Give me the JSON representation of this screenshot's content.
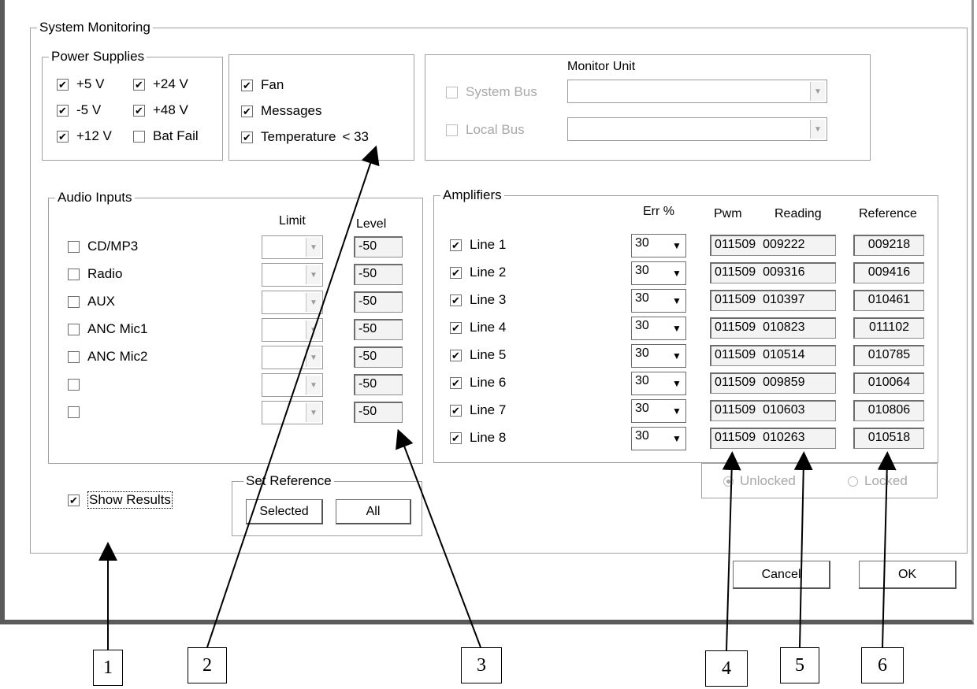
{
  "system_monitoring": {
    "title": "System Monitoring",
    "power_supplies": {
      "title": "Power Supplies",
      "items": [
        {
          "label": "+5 V",
          "checked": true
        },
        {
          "label": "+24 V",
          "checked": true
        },
        {
          "label": "-5 V",
          "checked": true
        },
        {
          "label": "+48 V",
          "checked": true
        },
        {
          "label": "+12 V",
          "checked": true
        },
        {
          "label": "Bat Fail",
          "checked": false
        }
      ]
    },
    "misc": {
      "fan": {
        "label": "Fan",
        "checked": true
      },
      "messages": {
        "label": "Messages",
        "checked": true
      },
      "temperature": {
        "label": "Temperature",
        "checked": true,
        "value": "< 33"
      }
    },
    "monitor_unit": {
      "title": "Monitor Unit",
      "system_bus": {
        "label": "System Bus",
        "checked": false,
        "value": ""
      },
      "local_bus": {
        "label": "Local Bus",
        "checked": false,
        "value": ""
      }
    },
    "audio_inputs": {
      "title": "Audio Inputs",
      "headers": {
        "limit": "Limit",
        "level": "Level"
      },
      "rows": [
        {
          "label": "CD/MP3",
          "checked": false,
          "limit": "",
          "level": "-50"
        },
        {
          "label": "Radio",
          "checked": false,
          "limit": "",
          "level": "-50"
        },
        {
          "label": "AUX",
          "checked": false,
          "limit": "",
          "level": "-50"
        },
        {
          "label": "ANC Mic1",
          "checked": false,
          "limit": "",
          "level": "-50"
        },
        {
          "label": "ANC Mic2",
          "checked": false,
          "limit": "",
          "level": "-50"
        },
        {
          "label": "",
          "checked": false,
          "limit": "",
          "level": "-50"
        },
        {
          "label": "",
          "checked": false,
          "limit": "",
          "level": "-50"
        }
      ]
    },
    "amplifiers": {
      "title": "Amplifiers",
      "headers": {
        "err": "Err %",
        "pwm": "Pwm",
        "reading": "Reading",
        "reference": "Reference"
      },
      "rows": [
        {
          "label": "Line 1",
          "checked": true,
          "err": "30",
          "pwm_reading": "011509  009222",
          "reference": "009218"
        },
        {
          "label": "Line 2",
          "checked": true,
          "err": "30",
          "pwm_reading": "011509  009316",
          "reference": "009416"
        },
        {
          "label": "Line 3",
          "checked": true,
          "err": "30",
          "pwm_reading": "011509  010397",
          "reference": "010461"
        },
        {
          "label": "Line 4",
          "checked": true,
          "err": "30",
          "pwm_reading": "011509  010823",
          "reference": "011102"
        },
        {
          "label": "Line 5",
          "checked": true,
          "err": "30",
          "pwm_reading": "011509  010514",
          "reference": "010785"
        },
        {
          "label": "Line 6",
          "checked": true,
          "err": "30",
          "pwm_reading": "011509  009859",
          "reference": "010064"
        },
        {
          "label": "Line 7",
          "checked": true,
          "err": "30",
          "pwm_reading": "011509  010603",
          "reference": "010806"
        },
        {
          "label": "Line 8",
          "checked": true,
          "err": "30",
          "pwm_reading": "011509  010263",
          "reference": "010518"
        }
      ],
      "lock": {
        "unlocked_label": "Unlocked",
        "locked_label": "Locked",
        "selected": "unlocked"
      }
    },
    "show_results": {
      "label": "Show Results",
      "checked": true
    },
    "set_reference": {
      "title": "Set Reference",
      "selected_label": "Selected",
      "all_label": "All"
    }
  },
  "buttons": {
    "cancel": "Cancel",
    "ok": "OK"
  },
  "callouts": [
    "1",
    "2",
    "3",
    "4",
    "5",
    "6"
  ]
}
